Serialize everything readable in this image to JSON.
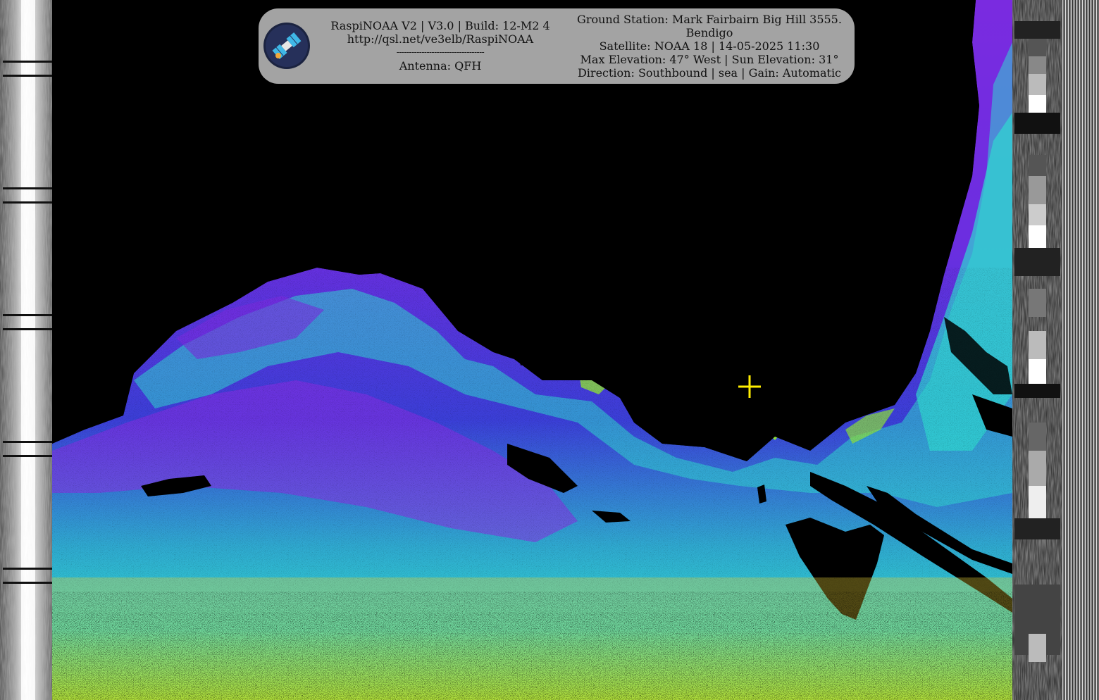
{
  "overlay": {
    "left": {
      "title": "RaspiNOAA V2 | V3.0 | Build: 12-M2 4",
      "url": "http://qsl.net/ve3elb/RaspiNOAA",
      "divider": "-----------------------------------",
      "antenna": "Antenna: QFH"
    },
    "right": {
      "station": "Ground Station: Mark Fairbairn Big Hill 3555.",
      "station_cont": "Bendigo",
      "satellite": "Satellite: NOAA 18 | 14-05-2025 11:30",
      "elevation": "Max Elevation: 47° West | Sun Elevation: 31°",
      "direction": "Direction: Southbound | sea | Gain: Automatic"
    },
    "logo_icon": "satellite-logo-icon"
  },
  "image": {
    "description_icon": "noaa-sea-temperature-false-color-map",
    "marker_icon": "ground-station-crosshair-icon",
    "colors": {
      "background": "#000000",
      "purple": "#7a2be0",
      "blue": "#3b3fd8",
      "cyan": "#2fd9d0",
      "teal": "#1fb5a8",
      "green": "#8fe23a",
      "yellow": "#e8d23a",
      "orange": "#e0822a",
      "marker": "#ffee00",
      "panel": "#a3a3a3"
    }
  }
}
